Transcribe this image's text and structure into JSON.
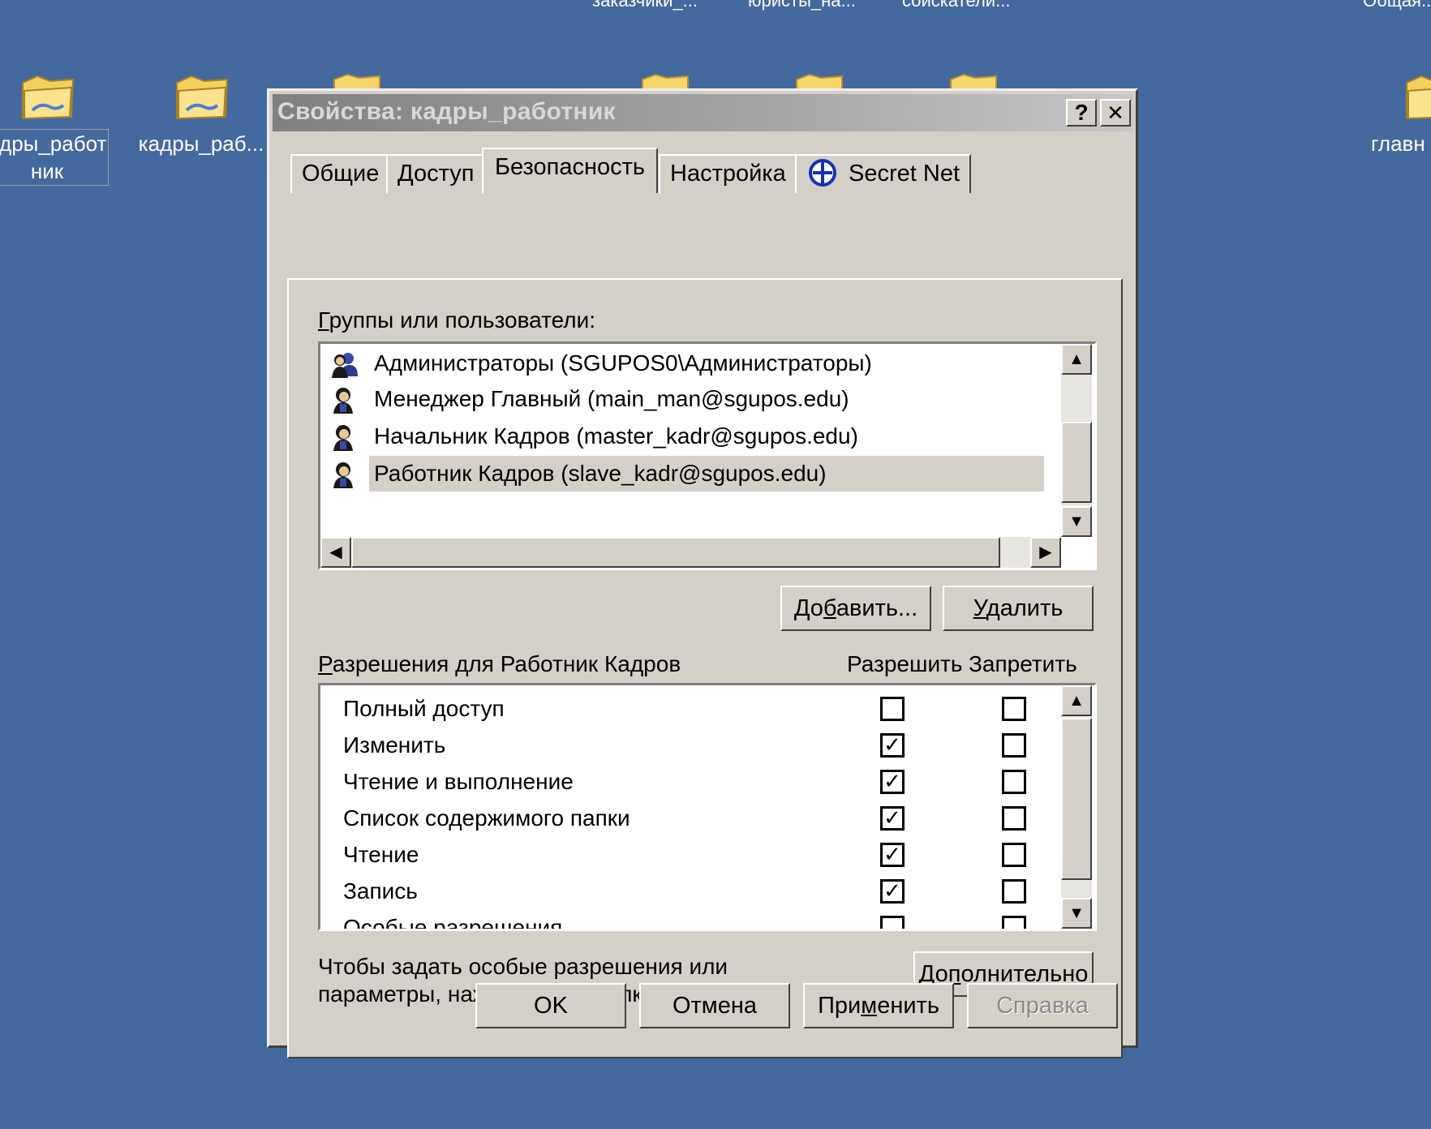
{
  "desktop": {
    "top_labels": [
      "заказчики_...",
      "юристы_на...",
      "соискатели...",
      "Общая..."
    ],
    "icons": [
      {
        "label_line1": "адры_работ",
        "label_line2": "ник",
        "icon": "folder-icon",
        "selected": true
      },
      {
        "label_line1": "кадры_раб...",
        "label_line2": "",
        "icon": "folder-icon",
        "selected": false
      },
      {
        "label_line1": "главн",
        "label_line2": "",
        "icon": "folder-icon",
        "selected": false
      }
    ]
  },
  "dialog": {
    "title": "Свойства: кадры_работник",
    "help_button": "?",
    "close_button": "✕",
    "tabs": [
      {
        "label": "Общие",
        "active": false
      },
      {
        "label": "Доступ",
        "active": false
      },
      {
        "label": "Безопасность",
        "active": true
      },
      {
        "label": "Настройка",
        "active": false
      },
      {
        "label": "Secret Net",
        "icon": "secret-net-icon",
        "active": false
      }
    ],
    "groups_label_first": "Г",
    "groups_label_rest": "руппы или пользователи:",
    "users": [
      {
        "name": "Администраторы (SGUPOS0\\Администраторы)",
        "icon": "users-group-icon",
        "selected": false
      },
      {
        "name": "Менеджер Главный (main_man@sgupos.edu)",
        "icon": "user-icon",
        "selected": false
      },
      {
        "name": "Начальник Кадров (master_kadr@sgupos.edu)",
        "icon": "user-icon",
        "selected": false
      },
      {
        "name": "Работник Кадров (slave_kadr@sgupos.edu)",
        "icon": "user-icon",
        "selected": true
      }
    ],
    "add_button": {
      "pre": "До",
      "ul": "б",
      "post": "авить..."
    },
    "remove_button": {
      "pre": "",
      "ul": "У",
      "post": "далить"
    },
    "permissions_label_first": "Р",
    "permissions_label_rest": "азрешения для Работник Кадров",
    "allow_header": "Разрешить",
    "deny_header": "Запретить",
    "permissions": [
      {
        "name": "Полный доступ",
        "allow": false,
        "deny": false
      },
      {
        "name": "Изменить",
        "allow": true,
        "deny": false
      },
      {
        "name": "Чтение и выполнение",
        "allow": true,
        "deny": false
      },
      {
        "name": "Список содержимого папки",
        "allow": true,
        "deny": false
      },
      {
        "name": "Чтение",
        "allow": true,
        "deny": false
      },
      {
        "name": "Запись",
        "allow": true,
        "deny": false
      },
      {
        "name": "Особые разрешения",
        "allow": false,
        "deny": false
      }
    ],
    "hint_line1": "Чтобы задать особые разрешения или",
    "hint_line2": "параметры, нажмите эту кнопку:",
    "advanced_button": {
      "pre": "До",
      "ul": "п",
      "post": "олнительно"
    },
    "ok_button": "OK",
    "cancel_button": "Отмена",
    "apply_button": {
      "pre": "При",
      "ul": "м",
      "post": "енить"
    },
    "help_footer_button": "Справка",
    "help_footer_enabled": false
  }
}
